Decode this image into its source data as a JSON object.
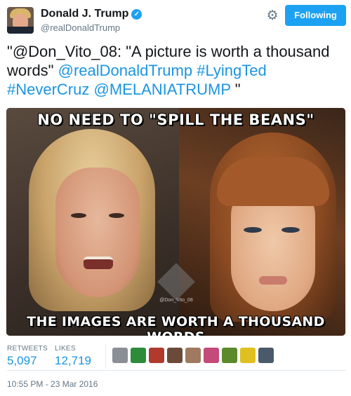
{
  "header": {
    "display_name": "Donald J. Trump",
    "handle": "@realDonaldTrump",
    "verified_icon": "✓",
    "follow_button": "Following",
    "accent_color": "#1da1f2"
  },
  "tweet": {
    "parts": [
      {
        "text": "\"",
        "link": false
      },
      {
        "text": "@Don_Vito_08",
        "link": false
      },
      {
        "text": ": \"A picture is worth a thousand words\" ",
        "link": false
      },
      {
        "text": "@realDonaldTrump",
        "link": true
      },
      {
        "text": "  ",
        "link": false
      },
      {
        "text": "#LyingTed",
        "link": true
      },
      {
        "text": " ",
        "link": false
      },
      {
        "text": "#NeverCruz",
        "link": true
      },
      {
        "text": "  ",
        "link": false
      },
      {
        "text": "@MELANIATRUMP",
        "link": true
      },
      {
        "text": " \"",
        "link": false
      }
    ]
  },
  "media": {
    "caption_top": "NO NEED TO \"SPILL THE BEANS\"",
    "caption_bottom": "THE IMAGES ARE WORTH A THOUSAND WORDS",
    "watermark": "@Don_Vito_08"
  },
  "stats": {
    "retweets_label": "RETWEETS",
    "retweets_value": "5,097",
    "likes_label": "LIKES",
    "likes_value": "12,719",
    "likers": [
      {
        "icon": "avatar-1",
        "color": "#8a8f96"
      },
      {
        "icon": "avatar-2",
        "color": "#2e8b3a"
      },
      {
        "icon": "avatar-3",
        "color": "#b03a2e"
      },
      {
        "icon": "avatar-4",
        "color": "#6b4a3a"
      },
      {
        "icon": "avatar-5",
        "color": "#a07a60"
      },
      {
        "icon": "avatar-6",
        "color": "#c44a7a"
      },
      {
        "icon": "avatar-7",
        "color": "#5a8a2a"
      },
      {
        "icon": "avatar-8",
        "color": "#e0c020"
      },
      {
        "icon": "avatar-9",
        "color": "#4a5a6a"
      }
    ]
  },
  "timestamp": "10:55 PM - 23 Mar 2016"
}
